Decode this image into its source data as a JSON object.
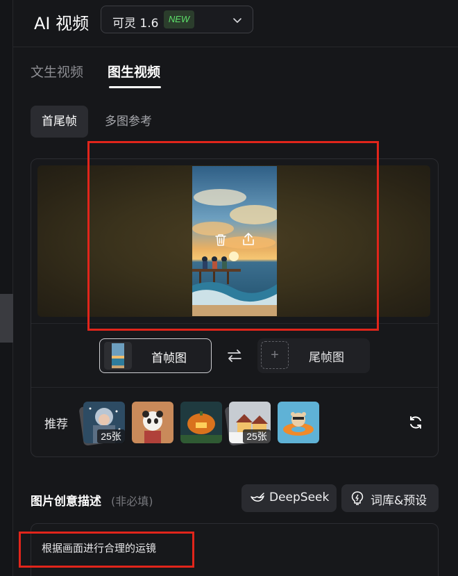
{
  "header": {
    "title": "AI 视频",
    "model_name": "可灵 1.6",
    "new_badge": "NEW"
  },
  "tabs": [
    {
      "label": "文生视频",
      "active": false
    },
    {
      "label": "图生视频",
      "active": true
    }
  ],
  "subtabs": [
    {
      "label": "首尾帧",
      "active": true
    },
    {
      "label": "多图参考",
      "active": false
    }
  ],
  "frame_controls": {
    "first_frame_label": "首帧图",
    "last_frame_label": "尾帧图",
    "swap_icon": "swap-arrows-icon"
  },
  "recommend": {
    "label": "推荐",
    "items": [
      {
        "subject": "girl-in-snow",
        "count": "25张"
      },
      {
        "subject": "panda"
      },
      {
        "subject": "pumpkin-house"
      },
      {
        "subject": "snowy-village",
        "count": "25张"
      },
      {
        "subject": "bear-on-float"
      }
    ]
  },
  "description": {
    "title": "图片创意描述",
    "optional": "(非必填)",
    "deepseek_label": "DeepSeek",
    "library_label": "词库&预设",
    "prompt": "根据画面进行合理的运镜"
  },
  "colors": {
    "accent_annotation": "#e1251b",
    "new_badge_text": "#5de06a",
    "background": "#16171a"
  }
}
